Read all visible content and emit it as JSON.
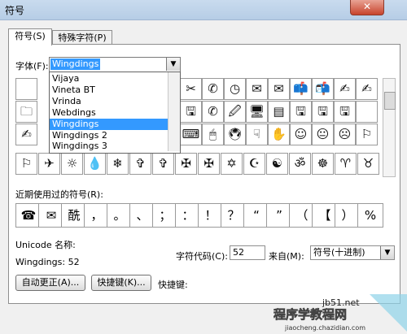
{
  "window": {
    "title": "符号",
    "close_label": "✕"
  },
  "tabs": [
    {
      "label": "符号(S)"
    },
    {
      "label": "特殊字符(P)"
    }
  ],
  "font": {
    "label": "字体(F):",
    "value": "Wingdings"
  },
  "font_dropdown": {
    "items": [
      "Vijaya",
      "Vineta BT",
      "Vrinda",
      "Webdings",
      "Wingdings",
      "Wingdings 2",
      "Wingdings 3"
    ],
    "selected": "Wingdings"
  },
  "symbol_grid": {
    "row0": [
      "✂",
      "✆",
      "◷",
      "✉",
      "✉",
      "📫",
      "📬",
      "✍",
      "✍"
    ],
    "row1": [
      "🗀",
      "🖫",
      "✆",
      "🖉",
      "🖥",
      "▤",
      "🖫",
      "🖫",
      "🖫"
    ],
    "row2": [
      "✍",
      "⌨",
      "🖱",
      "🖲",
      "☟",
      "✋",
      "☺",
      "😐",
      "☹",
      "💣",
      "☠",
      "⚐"
    ],
    "row3": [
      "⚐",
      "✈",
      "☼",
      "💧",
      "❄",
      "✞",
      "✞",
      "✠",
      "✠",
      "✡",
      "☪",
      "☯",
      "ॐ",
      "☸",
      "♈",
      "♉"
    ]
  },
  "recent": {
    "label": "近期使用过的符号(R):",
    "symbols": [
      "☎",
      "✉",
      "酰",
      "，",
      "。",
      "、",
      "；",
      "：",
      "！",
      "？",
      "“",
      "”",
      "（",
      "【",
      "）",
      "%"
    ]
  },
  "unicode": {
    "label": "Unicode 名称:",
    "name": "Wingdings: 52"
  },
  "char_code": {
    "label": "字符代码(C):",
    "value": "52"
  },
  "from": {
    "label": "来自(M):",
    "value": "符号(十进制)"
  },
  "buttons": {
    "autocorrect": "自动更正(A)...",
    "shortcut": "快捷键(K)...",
    "shortcut_label": "快捷键:"
  },
  "watermark": {
    "line1": "jb51.net",
    "line2": "程序学教程网",
    "line3": "jiaocheng.chazidian.com"
  }
}
